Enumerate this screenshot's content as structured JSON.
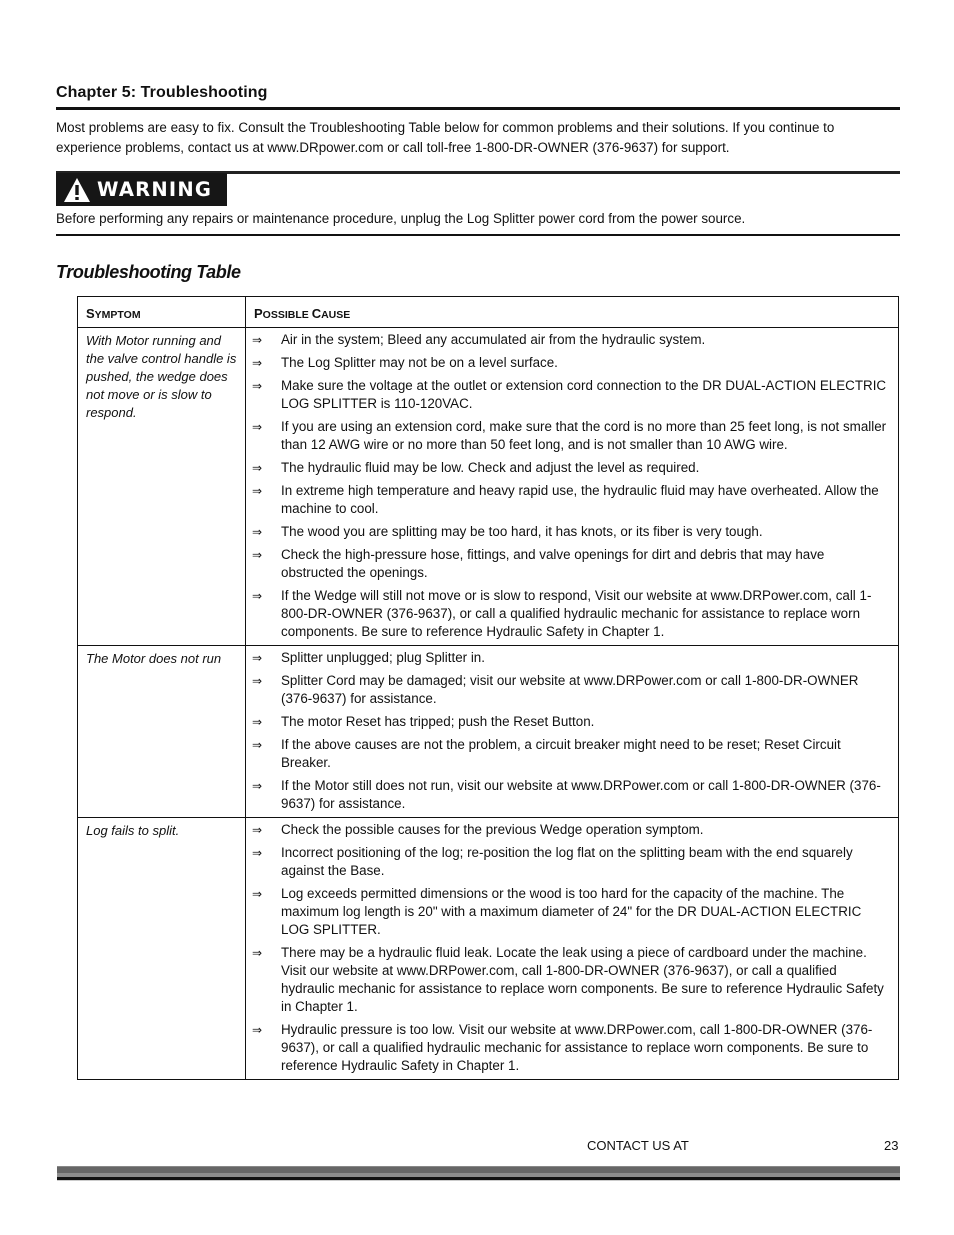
{
  "header": {
    "chapter_title": "Chapter 5: Troubleshooting",
    "intro": "Most problems are easy to fix. Consult the Troubleshooting Table below for common problems and their solutions. If you continue to experience problems, contact us at www.DRpower.com or call toll-free 1-800-DR-OWNER (376-9637) for support."
  },
  "warning": {
    "icon": "warning-triangle-icon",
    "label": "WARNING",
    "text": "Before performing any repairs or maintenance procedure, unplug the Log Splitter power cord from the power source."
  },
  "table": {
    "title": "Troubleshooting Table",
    "columns": [
      {
        "first": "S",
        "rest": "YMPTOM"
      },
      {
        "first": "P",
        "rest": "OSSIBLE ",
        "first2": "C",
        "rest2": "AUSE"
      }
    ],
    "bullet_icon": "⇒",
    "rows": [
      {
        "symptom": "With Motor running and the valve control handle is pushed, the wedge does not move or is slow to respond.",
        "causes": [
          "Air in the system; Bleed any accumulated air from the hydraulic system.",
          "The Log Splitter may not be on a level surface.",
          "Make sure the voltage at the outlet or extension cord connection to the DR DUAL-ACTION ELECTRIC LOG SPLITTER is 110-120VAC.",
          "If you are using an extension cord, make sure that the cord is no more than 25 feet long, is not smaller than 12 AWG wire or no more than 50 feet long, and is not smaller than 10 AWG wire.",
          "The hydraulic fluid may be low.  Check and adjust the level as required.",
          "In extreme high temperature and heavy rapid use, the hydraulic fluid may have overheated. Allow the machine to cool.",
          "The wood you are splitting may be too hard, it has knots, or its fiber is very tough.",
          "Check the high-pressure hose, fittings, and valve openings for dirt and debris that may have obstructed the openings.",
          "If the Wedge will still not move or is slow to respond, Visit our website at www.DRPower.com, call 1-800-DR-OWNER (376-9637), or call a qualified hydraulic mechanic for assistance to replace worn components.  Be sure to reference Hydraulic Safety in Chapter 1."
        ]
      },
      {
        "symptom": "The Motor does not run",
        "causes": [
          "Splitter unplugged; plug Splitter in.",
          "Splitter Cord may be damaged; visit our website at www.DRPower.com or call 1-800-DR-OWNER (376-9637) for assistance.",
          "The motor Reset has tripped; push the Reset Button.",
          "If the above causes are not the problem, a circuit breaker might need to be reset; Reset Circuit Breaker.",
          "If the Motor still does not run, visit our website at www.DRPower.com or call 1-800-DR-OWNER (376-9637) for assistance."
        ]
      },
      {
        "symptom": "Log fails to split.",
        "causes": [
          "Check the possible causes for the previous Wedge operation symptom.",
          "Incorrect positioning of the log; re-position the log flat on the splitting beam with the end squarely against the Base.",
          "Log exceeds permitted dimensions or the wood is too hard for the capacity of the machine. The maximum log length is 20\" with a maximum diameter of 24\" for the DR DUAL-ACTION ELECTRIC LOG SPLITTER.",
          "There may be a hydraulic fluid leak.  Locate the leak using a piece of cardboard under the machine.  Visit our website at www.DRPower.com, call 1-800-DR-OWNER (376-9637), or call a qualified hydraulic mechanic for assistance to replace worn components.  Be sure to reference Hydraulic Safety in Chapter 1.",
          "Hydraulic pressure is too low.  Visit our website at www.DRPower.com, call 1-800-DR-OWNER (376-9637), or call a qualified hydraulic mechanic for assistance to replace worn components.  Be sure to reference Hydraulic Safety in Chapter 1."
        ]
      }
    ]
  },
  "footer": {
    "contact_text": "CONTACT US AT",
    "page_number": "23"
  }
}
